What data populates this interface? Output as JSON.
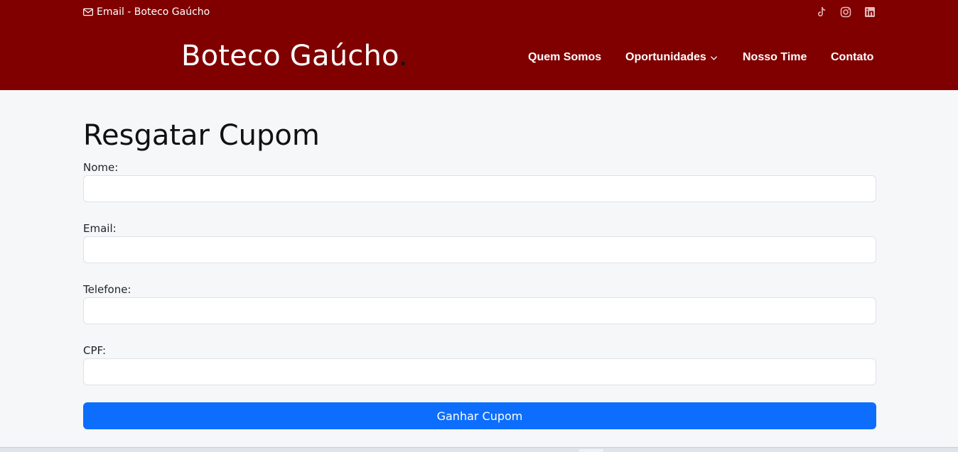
{
  "topbar": {
    "email_text": "Email - Boteco Gaúcho",
    "email_icon": "envelope-icon",
    "socials": [
      {
        "name": "tiktok-icon"
      },
      {
        "name": "instagram-icon"
      },
      {
        "name": "linkedin-icon"
      }
    ]
  },
  "brand": {
    "logo_text": "Boteco Gaúcho",
    "logo_dot": "."
  },
  "nav": {
    "items": [
      {
        "label": "Quem Somos"
      },
      {
        "label": "Oportunidades",
        "has_dropdown": true
      },
      {
        "label": "Nosso Time"
      },
      {
        "label": "Contato"
      }
    ]
  },
  "form": {
    "title": "Resgatar Cupom",
    "fields": [
      {
        "label": "Nome:",
        "value": ""
      },
      {
        "label": "Email:",
        "value": ""
      },
      {
        "label": "Telefone:",
        "value": ""
      },
      {
        "label": "CPF:",
        "value": ""
      }
    ],
    "submit_label": "Ganhar Cupom"
  },
  "colors": {
    "header_bg": "#800000",
    "page_bg": "#f6f7f9",
    "button_primary": "#0d6efd"
  }
}
